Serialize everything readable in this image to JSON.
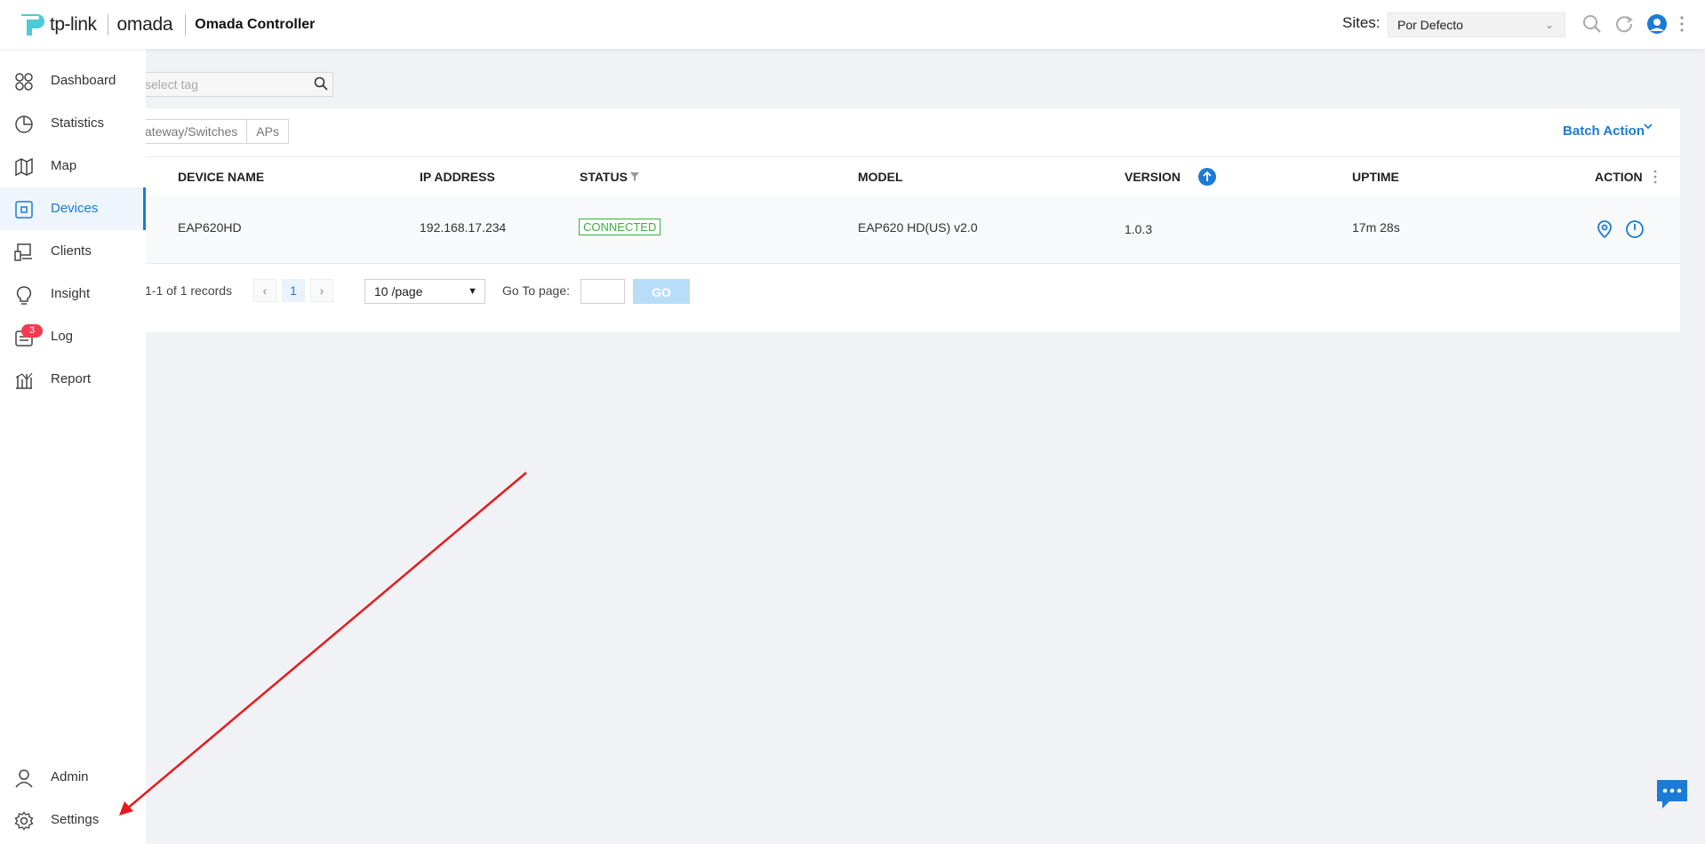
{
  "header": {
    "brand_tplink": "tp-link",
    "brand_omada": "omada",
    "app_title": "Omada Controller",
    "sites_label": "Sites:",
    "site_selected": "Por Defecto"
  },
  "sidebar": {
    "items": [
      {
        "label": "Dashboard",
        "icon": "dashboard-icon"
      },
      {
        "label": "Statistics",
        "icon": "pie-chart-icon"
      },
      {
        "label": "Map",
        "icon": "map-icon"
      },
      {
        "label": "Devices",
        "icon": "device-icon",
        "active": true
      },
      {
        "label": "Clients",
        "icon": "clients-icon"
      },
      {
        "label": "Insight",
        "icon": "lightbulb-icon"
      },
      {
        "label": "Log",
        "icon": "log-icon",
        "badge": "3"
      },
      {
        "label": "Report",
        "icon": "report-icon"
      }
    ],
    "bottom_items": [
      {
        "label": "Admin",
        "icon": "user-icon"
      },
      {
        "label": "Settings",
        "icon": "gear-icon"
      }
    ]
  },
  "toolbar": {
    "tag_placeholder": "select tag",
    "filters": [
      "ateway/Switches",
      "APs"
    ],
    "batch_action": "Batch Action"
  },
  "table": {
    "columns": [
      "DEVICE NAME",
      "IP ADDRESS",
      "STATUS",
      "MODEL",
      "VERSION",
      "UPTIME",
      "ACTION"
    ],
    "rows": [
      {
        "device_name": "EAP620HD",
        "ip": "192.168.17.234",
        "status": "CONNECTED",
        "model": "EAP620 HD(US) v2.0",
        "version": "1.0.3",
        "uptime": "17m 28s"
      }
    ]
  },
  "pagination": {
    "records": "1-1 of 1 records",
    "current_page": "1",
    "per_page": "10 /page",
    "goto_label": "Go To page:",
    "go_button": "GO"
  },
  "colors": {
    "accent": "#1b7bd6",
    "connected": "#36b23d",
    "badge": "#f5394f",
    "annotation_arrow": "#e8191c"
  }
}
